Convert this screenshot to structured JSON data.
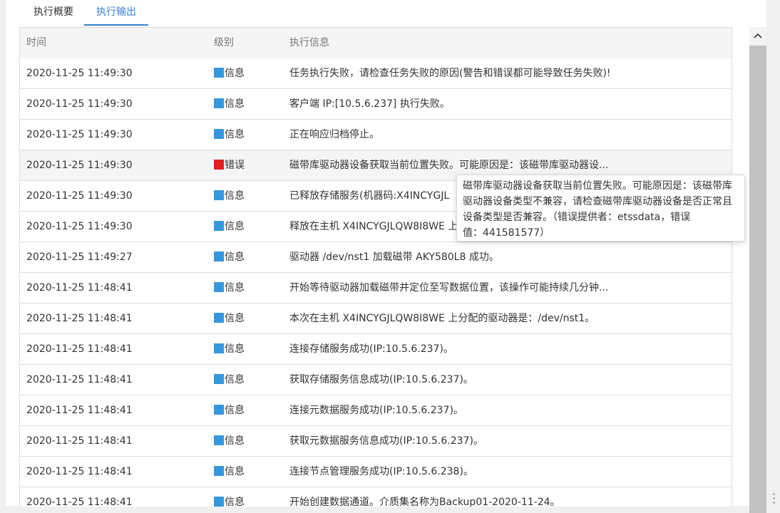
{
  "tabs": [
    {
      "label": "执行概要",
      "active": false
    },
    {
      "label": "执行输出",
      "active": true
    }
  ],
  "table": {
    "headers": {
      "time": "时间",
      "level": "级别",
      "message": "执行信息"
    },
    "rows": [
      {
        "time": "2020-11-25 11:49:30",
        "level": "信息",
        "level_type": "info",
        "message": "任务执行失败，请检查任务失败的原因(警告和错误都可能导致任务失败)!"
      },
      {
        "time": "2020-11-25 11:49:30",
        "level": "信息",
        "level_type": "info",
        "message": "客户端 IP:[10.5.6.237] 执行失败。"
      },
      {
        "time": "2020-11-25 11:49:30",
        "level": "信息",
        "level_type": "info",
        "message": "正在响应归档停止。"
      },
      {
        "time": "2020-11-25 11:49:30",
        "level": "错误",
        "level_type": "error",
        "message": "磁带库驱动器设备获取当前位置失败。可能原因是：该磁带库驱动器设..."
      },
      {
        "time": "2020-11-25 11:49:30",
        "level": "信息",
        "level_type": "info",
        "message": "已释放存储服务(机器码:X4INCYGJL"
      },
      {
        "time": "2020-11-25 11:49:30",
        "level": "信息",
        "level_type": "info",
        "message": "释放在主机 X4INCYGJLQW8I8WE 上"
      },
      {
        "time": "2020-11-25 11:49:27",
        "level": "信息",
        "level_type": "info",
        "message": "驱动器 /dev/nst1 加载磁带 AKY580L8 成功。"
      },
      {
        "time": "2020-11-25 11:48:41",
        "level": "信息",
        "level_type": "info",
        "message": "开始等待驱动器加载磁带并定位至写数据位置，该操作可能持续几分钟..."
      },
      {
        "time": "2020-11-25 11:48:41",
        "level": "信息",
        "level_type": "info",
        "message": "本次在主机 X4INCYGJLQW8I8WE 上分配的驱动器是：/dev/nst1。"
      },
      {
        "time": "2020-11-25 11:48:41",
        "level": "信息",
        "level_type": "info",
        "message": "连接存储服务成功(IP:10.5.6.237)。"
      },
      {
        "time": "2020-11-25 11:48:41",
        "level": "信息",
        "level_type": "info",
        "message": "获取存储服务信息成功(IP:10.5.6.237)。"
      },
      {
        "time": "2020-11-25 11:48:41",
        "level": "信息",
        "level_type": "info",
        "message": "连接元数据服务成功(IP:10.5.6.237)。"
      },
      {
        "time": "2020-11-25 11:48:41",
        "level": "信息",
        "level_type": "info",
        "message": "获取元数据服务信息成功(IP:10.5.6.237)。"
      },
      {
        "time": "2020-11-25 11:48:41",
        "level": "信息",
        "level_type": "info",
        "message": "连接节点管理服务成功(IP:10.5.6.238)。"
      },
      {
        "time": "2020-11-25 11:48:41",
        "level": "信息",
        "level_type": "info",
        "message": "开始创建数据通道。介质集名称为Backup01-2020-11-24。"
      }
    ]
  },
  "tooltip": {
    "lines": [
      "磁带库驱动器设备获取当前位置失败。可能原因是：该磁带库",
      "驱动器设备类型不兼容，请检查磁带库驱动器设备是否正常且",
      "设备类型是否兼容。（错误提供者：etssdata，错误",
      "值：441581577）"
    ]
  },
  "colors": {
    "info": "#3498e0",
    "error": "#e02020",
    "accent": "#3b7fd0"
  },
  "icons": {
    "scroll_up": "chevron-up-icon"
  }
}
